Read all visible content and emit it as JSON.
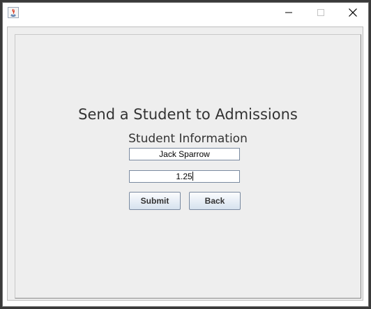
{
  "window": {
    "controls": [
      "minimize",
      "maximize",
      "close"
    ]
  },
  "form": {
    "title": "Send a Student to Admissions",
    "subtitle": "Student Information",
    "name_value": "Jack Sparrow",
    "gpa_value": "1.25",
    "submit_label": "Submit",
    "back_label": "Back"
  },
  "icons": {
    "app": "java-icon",
    "minimize": "minimize-icon",
    "maximize": "maximize-icon",
    "close": "close-icon"
  }
}
